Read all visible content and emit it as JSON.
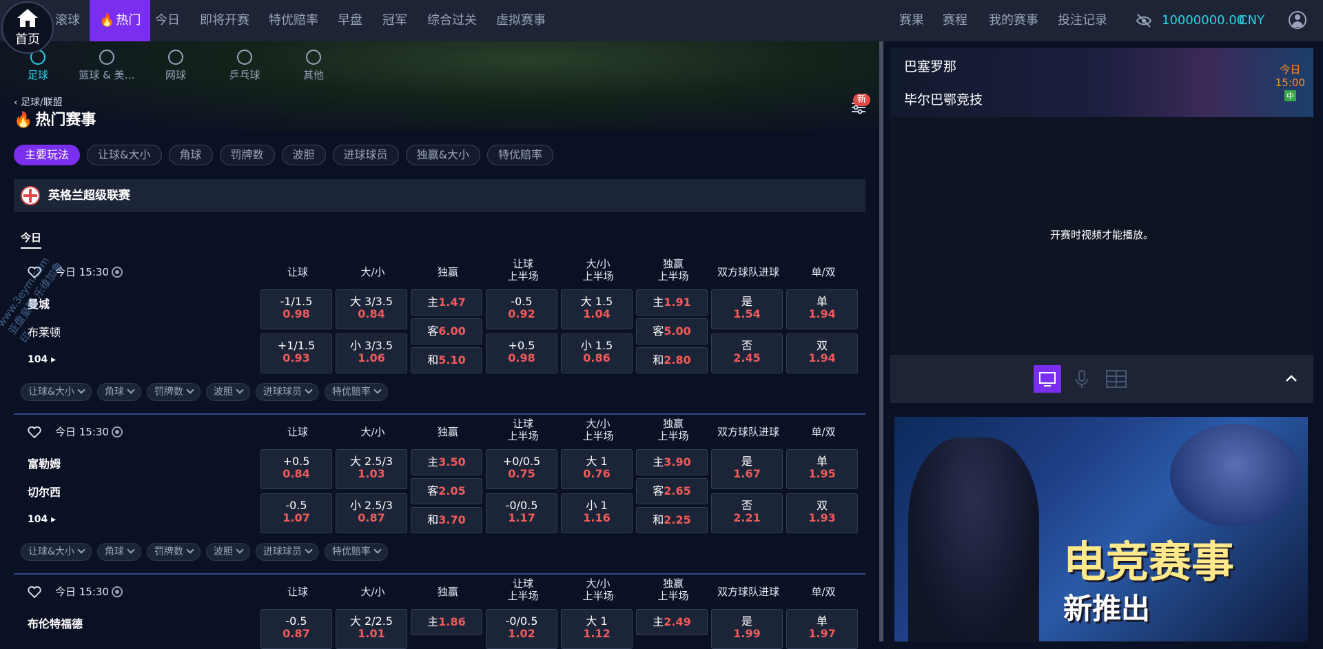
{
  "topnav": {
    "home_label": "首页",
    "items": [
      "滚球",
      "热门",
      "今日",
      "即将开赛",
      "特优赔率",
      "早盘",
      "冠军",
      "综合过关",
      "虚拟赛事"
    ],
    "right_items": [
      "赛果",
      "赛程",
      "我的赛事",
      "投注记录"
    ],
    "balance": "10000000.00",
    "currency": "CNY"
  },
  "sports": [
    "足球",
    "篮球 & 美…",
    "网球",
    "乒乓球",
    "其他"
  ],
  "breadcrumb": "足球/联盟",
  "page_title": "热门赛事",
  "new_badge": "新",
  "chips": [
    "主要玩法",
    "让球&大小",
    "角球",
    "罚牌数",
    "波胆",
    "进球球员",
    "独赢&大小",
    "特优赔率"
  ],
  "league": "英格兰超级联赛",
  "day_tab": "今日",
  "columns": [
    {
      "l1": "让球",
      "l2": ""
    },
    {
      "l1": "大/小",
      "l2": ""
    },
    {
      "l1": "独赢",
      "l2": ""
    },
    {
      "l1": "让球",
      "l2": "上半场"
    },
    {
      "l1": "大/小",
      "l2": "上半场"
    },
    {
      "l1": "独赢",
      "l2": "上半场"
    },
    {
      "l1": "双方球队进球",
      "l2": ""
    },
    {
      "l1": "单/双",
      "l2": ""
    }
  ],
  "sub_chips": [
    "让球&大小",
    "角球",
    "罚牌数",
    "波胆",
    "进球球员",
    "特优赔率"
  ],
  "matches": [
    {
      "time": "今日 15:30",
      "home": "曼城",
      "away": "布莱顿",
      "more": "104",
      "hcap": [
        {
          "l": "-1/1.5",
          "v": "0.98"
        },
        {
          "l": "+1/1.5",
          "v": "0.93"
        }
      ],
      "ou": [
        {
          "l": "大 3/3.5",
          "v": "0.84"
        },
        {
          "l": "小 3/3.5",
          "v": "1.06"
        }
      ],
      "win": [
        {
          "l": "主",
          "v": "1.47"
        },
        {
          "l": "客",
          "v": "6.00"
        },
        {
          "l": "和",
          "v": "5.10"
        }
      ],
      "hcap_h": [
        {
          "l": "-0.5",
          "v": "0.92"
        },
        {
          "l": "+0.5",
          "v": "0.98"
        }
      ],
      "ou_h": [
        {
          "l": "大 1.5",
          "v": "1.04"
        },
        {
          "l": "小 1.5",
          "v": "0.86"
        }
      ],
      "win_h": [
        {
          "l": "主",
          "v": "1.91"
        },
        {
          "l": "客",
          "v": "5.00"
        },
        {
          "l": "和",
          "v": "2.80"
        }
      ],
      "btts": [
        {
          "l": "是",
          "v": "1.54"
        },
        {
          "l": "否",
          "v": "2.45"
        }
      ],
      "oe": [
        {
          "l": "单",
          "v": "1.94"
        },
        {
          "l": "双",
          "v": "1.94"
        }
      ]
    },
    {
      "time": "今日 15:30",
      "home": "富勒姆",
      "away": "切尔西",
      "more": "104",
      "hcap": [
        {
          "l": "+0.5",
          "v": "0.84"
        },
        {
          "l": "-0.5",
          "v": "1.07"
        }
      ],
      "ou": [
        {
          "l": "大 2.5/3",
          "v": "1.03"
        },
        {
          "l": "小 2.5/3",
          "v": "0.87"
        }
      ],
      "win": [
        {
          "l": "主",
          "v": "3.50"
        },
        {
          "l": "客",
          "v": "2.05"
        },
        {
          "l": "和",
          "v": "3.70"
        }
      ],
      "hcap_h": [
        {
          "l": "+0/0.5",
          "v": "0.75"
        },
        {
          "l": "-0/0.5",
          "v": "1.17"
        }
      ],
      "ou_h": [
        {
          "l": "大 1",
          "v": "0.76"
        },
        {
          "l": "小 1",
          "v": "1.16"
        }
      ],
      "win_h": [
        {
          "l": "主",
          "v": "3.90"
        },
        {
          "l": "客",
          "v": "2.65"
        },
        {
          "l": "和",
          "v": "2.25"
        }
      ],
      "btts": [
        {
          "l": "是",
          "v": "1.67"
        },
        {
          "l": "否",
          "v": "2.21"
        }
      ],
      "oe": [
        {
          "l": "单",
          "v": "1.95"
        },
        {
          "l": "双",
          "v": "1.93"
        }
      ]
    },
    {
      "time": "今日 15:30",
      "home": "布伦特福德",
      "hcap": [
        {
          "l": "-0.5",
          "v": "0.87"
        }
      ],
      "ou": [
        {
          "l": "大 2/2.5",
          "v": "1.01"
        }
      ],
      "win": [
        {
          "l": "主",
          "v": "1.86"
        }
      ],
      "hcap_h": [
        {
          "l": "-0/0.5",
          "v": "1.02"
        }
      ],
      "ou_h": [
        {
          "l": "大 1",
          "v": "1.12"
        }
      ],
      "win_h": [
        {
          "l": "主",
          "v": "2.49"
        }
      ],
      "btts": [
        {
          "l": "是",
          "v": "1.99"
        }
      ],
      "oe": [
        {
          "l": "单",
          "v": "1.97"
        }
      ]
    }
  ],
  "right_panel": {
    "home_team": "巴塞罗那",
    "away_team": "毕尔巴鄂竞技",
    "day": "今日",
    "time": "15:00",
    "tag": "中",
    "video_msg": "开赛时视频才能播放。",
    "banner_title": "电竞赛事",
    "banner_sub": "新推出"
  },
  "watermark": "www.3eym.com 亚盘皇冠 乐维加鲁印",
  "colors": {
    "accent": "#7a2ff0",
    "odds": "#f05b5b",
    "balance": "#2ed0e8",
    "sport_active": "#2ed0e8"
  }
}
